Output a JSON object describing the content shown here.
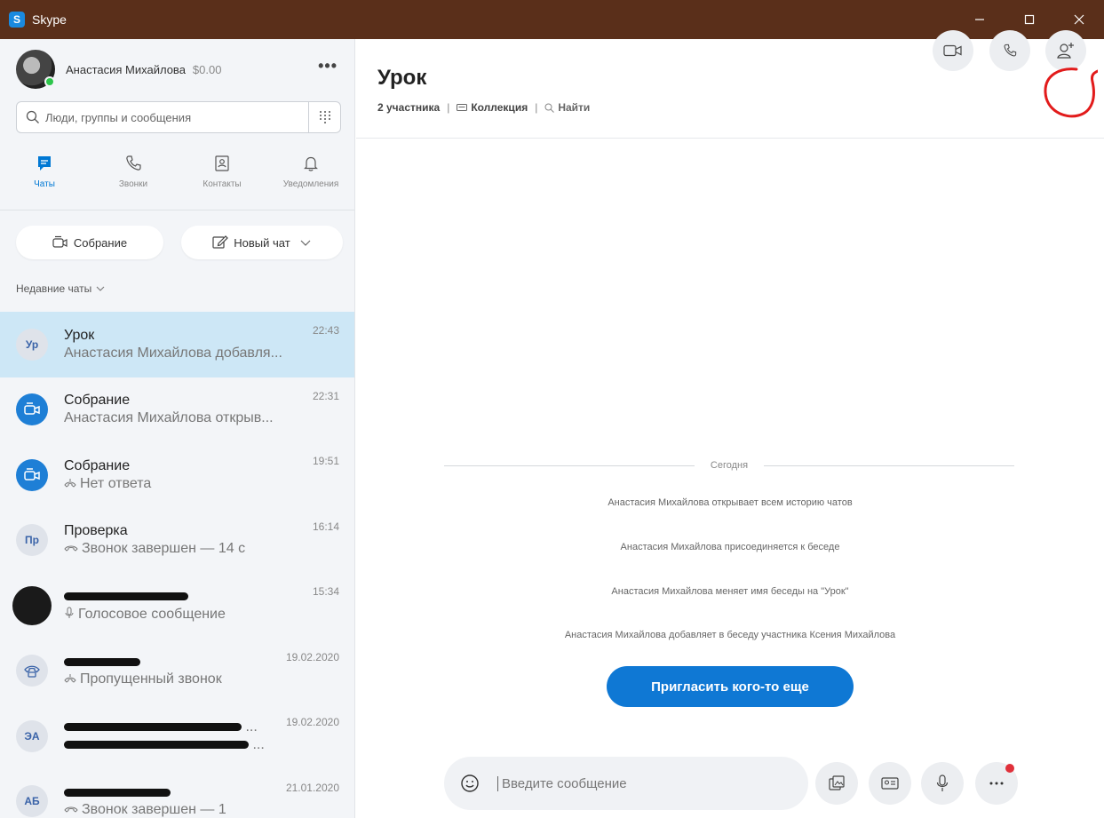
{
  "window": {
    "title": "Skype",
    "logo_letter": "S"
  },
  "profile": {
    "name": "Анастасия Михайлова",
    "balance": "$0.00",
    "more": "•••"
  },
  "search": {
    "placeholder": "Люди, группы и сообщения"
  },
  "nav": [
    {
      "label": "Чаты",
      "icon": "chat-icon",
      "active": true
    },
    {
      "label": "Звонки",
      "icon": "phone-icon"
    },
    {
      "label": "Контакты",
      "icon": "contacts-icon"
    },
    {
      "label": "Уведомления",
      "icon": "bell-icon"
    }
  ],
  "actions": {
    "meeting": "Собрание",
    "new_chat": "Новый чат"
  },
  "recent_header": "Недавние чаты",
  "chats": [
    {
      "initials": "Ур",
      "title": "Урок",
      "preview": "Анастасия Михайлова добавля...",
      "time": "22:43",
      "selected": true
    },
    {
      "title": "Собрание",
      "preview": "Анастасия Михайлова открыв...",
      "time": "22:31",
      "avatar": "meeting"
    },
    {
      "title": "Собрание",
      "preview": "Нет ответа",
      "time": "19:51",
      "avatar": "meeting"
    },
    {
      "initials": "Пр",
      "title": "Проверка",
      "preview": "Звонок завершен — 14 с",
      "time": "16:14"
    },
    {
      "title": "",
      "preview": "Голосовое сообщение",
      "time": "15:34",
      "avatar": "photo",
      "title_redacted": true
    },
    {
      "title": "",
      "preview": "Пропущенный звонок",
      "time": "19.02.2020",
      "avatar": "phone",
      "title_redacted": true
    },
    {
      "initials": "ЭА",
      "title": "...",
      "preview": "...",
      "time": "19.02.2020",
      "title_redacted": true,
      "preview_redacted": true
    },
    {
      "initials": "АБ",
      "title": "",
      "preview": "Звонок завершен — 1",
      "time": "21.01.2020",
      "title_redacted": true
    }
  ],
  "conversation": {
    "title": "Урок",
    "participants": "2 участника",
    "gallery": "Коллекция",
    "find": "Найти",
    "day_label": "Сегодня",
    "messages": [
      "Анастасия Михайлова открывает всем историю чатов",
      "Анастасия Михайлова присоединяется к беседе",
      "Анастасия Михайлова меняет имя беседы на \"Урок\"",
      "Анастасия Михайлова добавляет в беседу участника Ксения Михайлова"
    ],
    "invite_button": "Пригласить кого-то еще"
  },
  "composer": {
    "placeholder": "Введите сообщение"
  },
  "colors": {
    "accent": "#0f78d4",
    "titlebar": "#5a2f1a",
    "selected": "#cde7f6",
    "annotation": "#e21b1b"
  }
}
